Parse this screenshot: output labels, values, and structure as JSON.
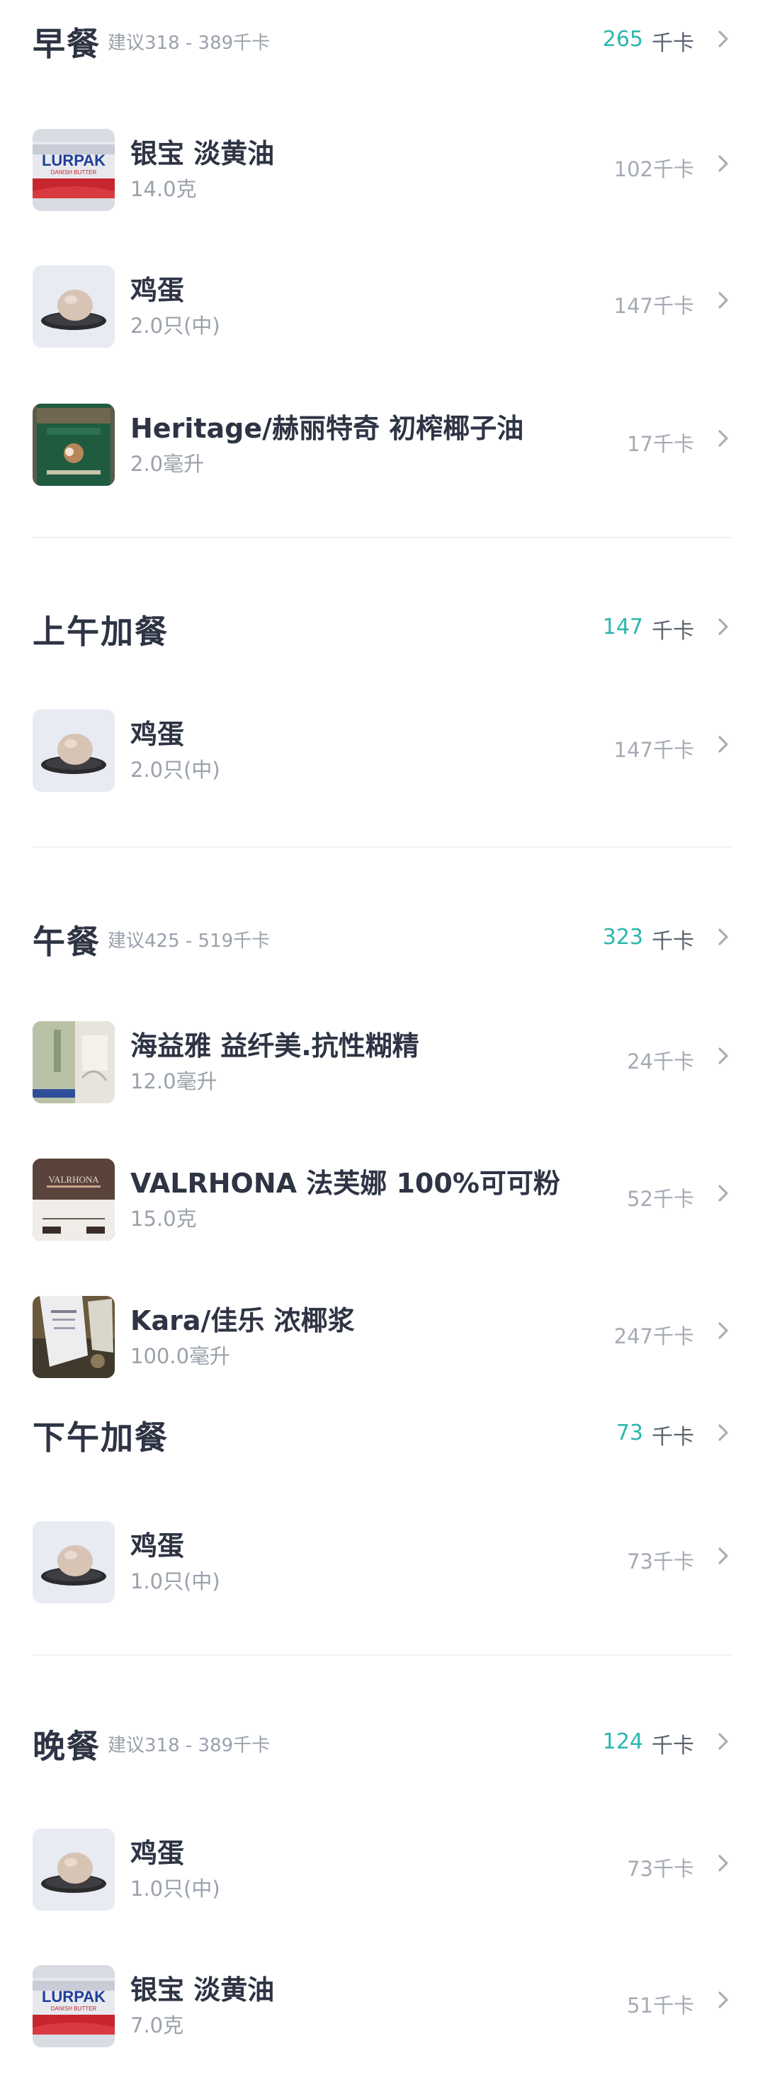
{
  "meals": [
    {
      "title": "早餐",
      "suggest": "建议318 - 389千卡",
      "total": "265",
      "unit": "千卡",
      "foods": [
        {
          "name": "银宝 淡黄油",
          "amount": "14.0克",
          "kcal": "102千卡",
          "thumb": "butter-lurpak"
        },
        {
          "name": "鸡蛋",
          "amount": "2.0只(中)",
          "kcal": "147千卡",
          "thumb": "egg"
        },
        {
          "name": "Heritage/赫丽特奇 初榨椰子油",
          "amount": "2.0毫升",
          "kcal": "17千卡",
          "thumb": "coconut-oil-jar"
        }
      ]
    },
    {
      "title": "上午加餐",
      "suggest": "",
      "total": "147",
      "unit": "千卡",
      "foods": [
        {
          "name": "鸡蛋",
          "amount": "2.0只(中)",
          "kcal": "147千卡",
          "thumb": "egg"
        }
      ]
    },
    {
      "title": "午餐",
      "suggest": "建议425 - 519千卡",
      "total": "323",
      "unit": "千卡",
      "foods": [
        {
          "name": "海益雅 益纤美.抗性糊精",
          "amount": "12.0毫升",
          "kcal": "24千卡",
          "thumb": "fiber-box"
        },
        {
          "name": "VALRHONA 法芙娜 100%可可粉",
          "amount": "15.0克",
          "kcal": "52千卡",
          "thumb": "cocoa-bag"
        },
        {
          "name": "Kara/佳乐 浓椰浆",
          "amount": "100.0毫升",
          "kcal": "247千卡",
          "thumb": "coconut-cream-pack"
        }
      ]
    },
    {
      "title": "下午加餐",
      "suggest": "",
      "total": "73",
      "unit": "千卡",
      "foods": [
        {
          "name": "鸡蛋",
          "amount": "1.0只(中)",
          "kcal": "73千卡",
          "thumb": "egg"
        }
      ]
    },
    {
      "title": "晚餐",
      "suggest": "建议318 - 389千卡",
      "total": "124",
      "unit": "千卡",
      "foods": [
        {
          "name": "鸡蛋",
          "amount": "1.0只(中)",
          "kcal": "73千卡",
          "thumb": "egg"
        },
        {
          "name": "银宝 淡黄油",
          "amount": "7.0克",
          "kcal": "51千卡",
          "thumb": "butter-lurpak"
        }
      ]
    }
  ],
  "colors": {
    "accent": "#2bb6ae",
    "title": "#2e3444",
    "muted": "#9aa1ab",
    "divider": "#eef0f3",
    "chevron": "#a9aeb6"
  },
  "thumb_text": {
    "lurpak": "LURPAK",
    "lurpak_sub": "DANISH BUTTER",
    "valrhona": "VALRHONA"
  }
}
